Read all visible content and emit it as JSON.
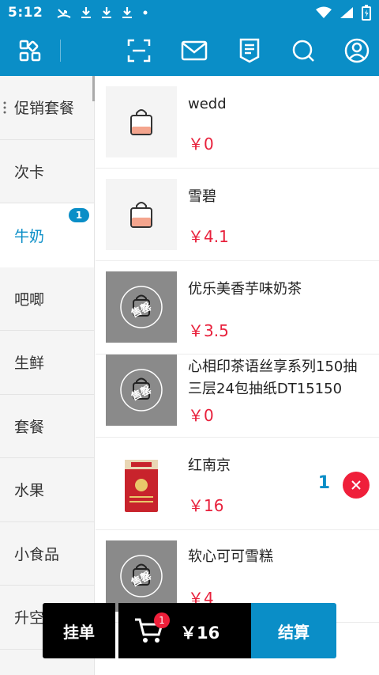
{
  "status_bar": {
    "time": "5:12",
    "left_icons": [
      "missed-call-icon",
      "download-icon",
      "download-icon",
      "download-icon",
      "dot-icon"
    ],
    "right_icons": [
      "wifi-icon",
      "signal-icon",
      "battery-charging-icon"
    ]
  },
  "toolbar": {
    "icons": [
      "grid-icon",
      "scan-icon",
      "mail-icon",
      "receipt-icon",
      "search-icon",
      "user-icon"
    ]
  },
  "categories": [
    {
      "label": "促销套餐",
      "active": false
    },
    {
      "label": "次卡",
      "active": false
    },
    {
      "label": "牛奶",
      "active": true,
      "badge": "1"
    },
    {
      "label": "吧唧",
      "active": false
    },
    {
      "label": "生鲜",
      "active": false
    },
    {
      "label": "套餐",
      "active": false
    },
    {
      "label": "水果",
      "active": false
    },
    {
      "label": "小食品",
      "active": false
    },
    {
      "label": "升空",
      "active": false
    }
  ],
  "products": [
    {
      "name": "wedd",
      "price": "￥0",
      "image": "bag-icon"
    },
    {
      "name": "雪碧",
      "price": "￥4.1",
      "image": "bag-icon"
    },
    {
      "name": "优乐美香芋味奶茶",
      "price": "￥3.5",
      "image": "soldout-icon",
      "stamp": "售罄"
    },
    {
      "name": "心相印茶语丝享系列150抽三层24包抽纸DT15150",
      "price": "￥0",
      "image": "soldout-icon",
      "stamp": "售罄"
    },
    {
      "name": "红南京",
      "price": "￥16",
      "image": "cigarette-pack-icon",
      "qty": "1"
    },
    {
      "name": "软心可可雪糕",
      "price": "￥4",
      "image": "soldout-icon",
      "stamp": "售罄"
    }
  ],
  "bottom_bar": {
    "hold_label": "挂单",
    "cart_count": "1",
    "total": "￥16",
    "checkout_label": "结算"
  },
  "colors": {
    "brand": "#0a8ec7",
    "price": "#e8213c",
    "badge_red": "#ef1f3a"
  }
}
